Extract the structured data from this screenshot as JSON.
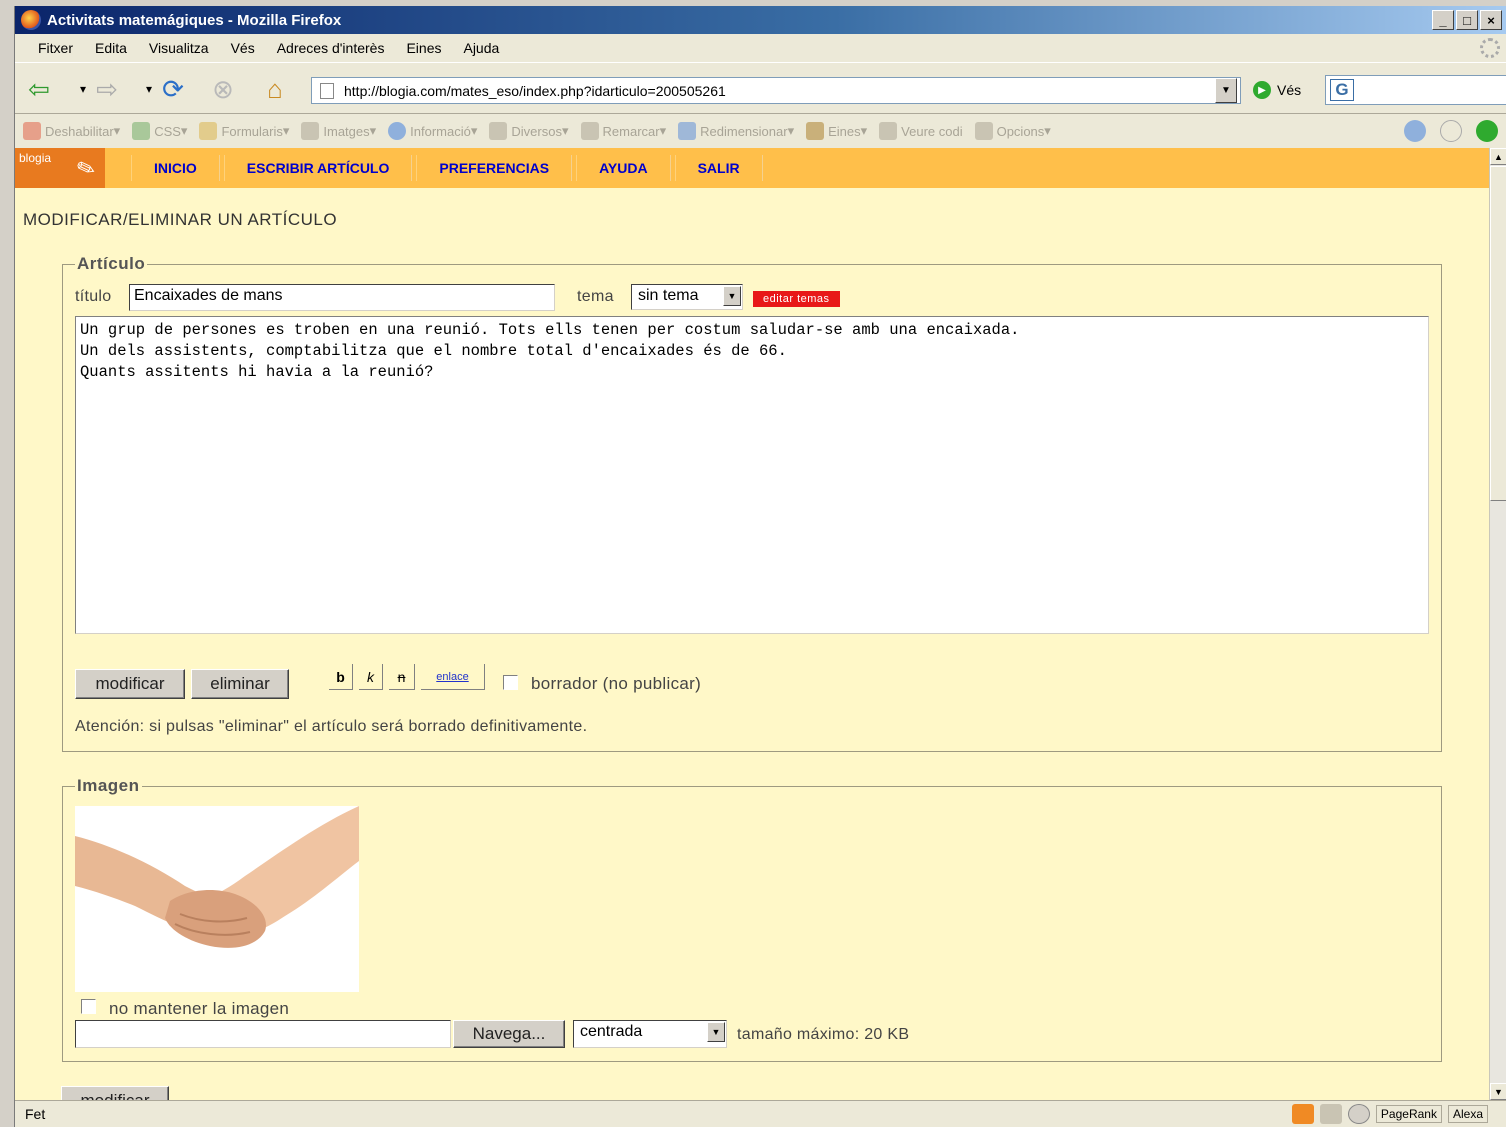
{
  "window": {
    "title": "Activitats matemágiques - Mozilla Firefox"
  },
  "menu": [
    "Fitxer",
    "Edita",
    "Visualitza",
    "Vés",
    "Adreces d'interès",
    "Eines",
    "Ajuda"
  ],
  "navbar": {
    "url": "http://blogia.com/mates_eso/index.php?idarticulo=200505261",
    "go_label": "Vés"
  },
  "devbar": [
    "Deshabilitar",
    "CSS",
    "Formularis",
    "Imatges",
    "Informació",
    "Diversos",
    "Remarcar",
    "Redimensionar",
    "Eines",
    "Veure codi",
    "Opcions"
  ],
  "blog": {
    "logo": "blogia",
    "nav": [
      "INICIO",
      "ESCRIBIR ARTÍCULO",
      "PREFERENCIAS",
      "AYUDA",
      "SALIR"
    ]
  },
  "page": {
    "title": "MODIFICAR/ELIMINAR UN ARTÍCULO",
    "article": {
      "legend": "Artículo",
      "title_label": "título",
      "title_value": "Encaixades de mans",
      "tema_label": "tema",
      "tema_value": "sin tema",
      "edit_temas": "editar temas",
      "body": "Un grup de persones es troben en una reunió. Tots ells tenen per costum saludar-se amb una encaixada.\nUn dels assistents, comptabilitza que el nombre total d'encaixades és de 66.\nQuants assitents hi havia a la reunió?",
      "modify_button": "modificar",
      "delete_button": "eliminar",
      "fmt_bold": "b",
      "fmt_italic": "k",
      "fmt_strike": "n",
      "fmt_link": "enlace",
      "draft_label": "borrador (no publicar)",
      "warning": "Atención: si pulsas \"eliminar\" el artículo será borrado definitivamente."
    },
    "image": {
      "legend": "Imagen",
      "keep_label": "no mantener la imagen",
      "browse_button": "Navega...",
      "align_value": "centrada",
      "max_size": "tamaño máximo: 20 KB"
    },
    "bottom_button": "modificar"
  },
  "status": {
    "text": "Fet",
    "pagerank": "PageRank",
    "alexa": "Alexa"
  }
}
